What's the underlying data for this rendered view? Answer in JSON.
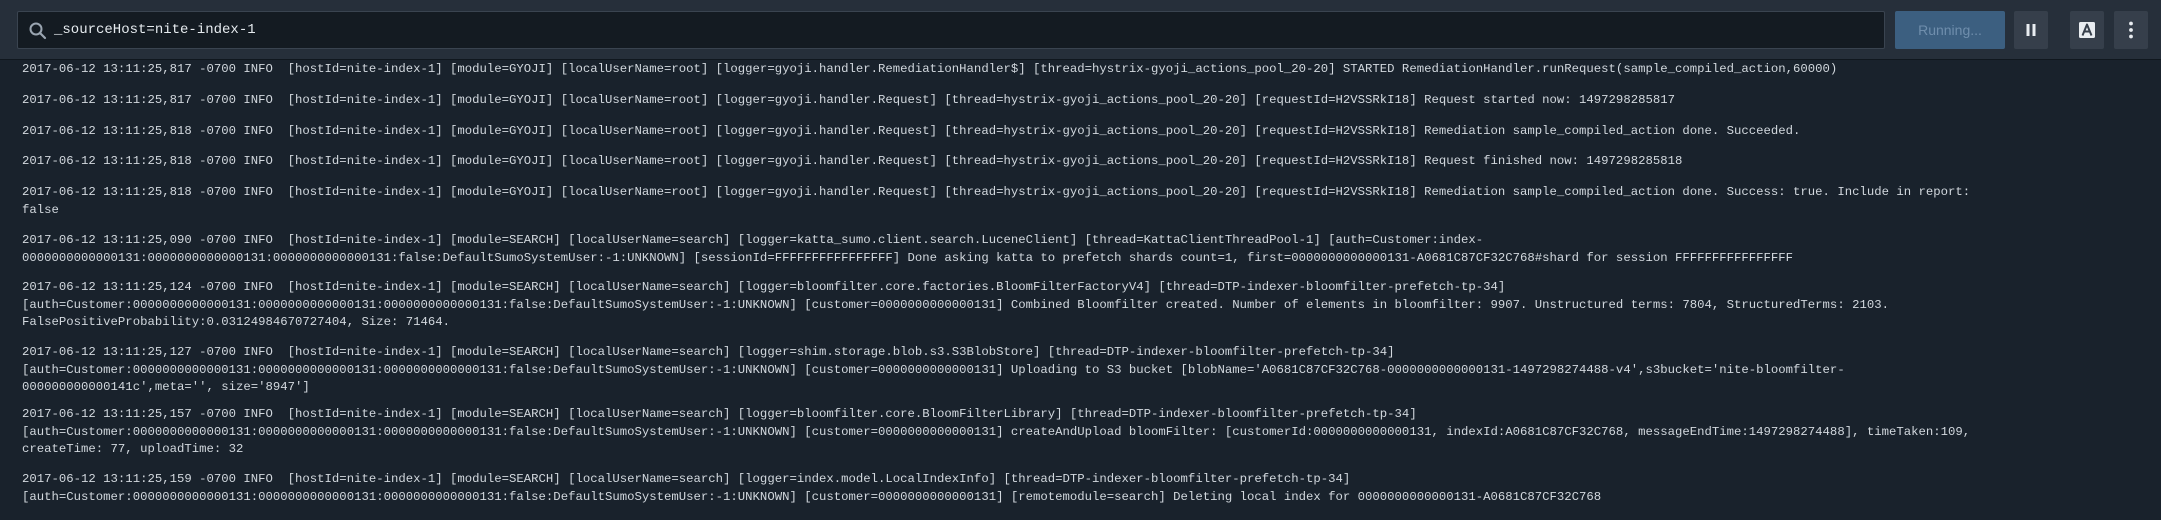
{
  "search": {
    "query": "_sourceHost=nite-index-1"
  },
  "controls": {
    "running_label": "Running..."
  },
  "colors": {
    "toolbar_bg": "#262f3a",
    "log_bg": "#19222c",
    "running_button": "#3c5f80"
  },
  "logs": [
    "2017-06-12 13:11:25,817 -0700 INFO  [hostId=nite-index-1] [module=GYOJI] [localUserName=root] [logger=gyoji.handler.RemediationHandler$] [thread=hystrix-gyoji_actions_pool_20-20] STARTED RemediationHandler.runRequest(sample_compiled_action,60000)",
    "2017-06-12 13:11:25,817 -0700 INFO  [hostId=nite-index-1] [module=GYOJI] [localUserName=root] [logger=gyoji.handler.Request] [thread=hystrix-gyoji_actions_pool_20-20] [requestId=H2VSSRkI18] Request started now: 1497298285817",
    "2017-06-12 13:11:25,818 -0700 INFO  [hostId=nite-index-1] [module=GYOJI] [localUserName=root] [logger=gyoji.handler.Request] [thread=hystrix-gyoji_actions_pool_20-20] [requestId=H2VSSRkI18] Remediation sample_compiled_action done. Succeeded.",
    "2017-06-12 13:11:25,818 -0700 INFO  [hostId=nite-index-1] [module=GYOJI] [localUserName=root] [logger=gyoji.handler.Request] [thread=hystrix-gyoji_actions_pool_20-20] [requestId=H2VSSRkI18] Request finished now: 1497298285818",
    "2017-06-12 13:11:25,818 -0700 INFO  [hostId=nite-index-1] [module=GYOJI] [localUserName=root] [logger=gyoji.handler.Request] [thread=hystrix-gyoji_actions_pool_20-20] [requestId=H2VSSRkI18] Remediation sample_compiled_action done. Success: true. Include in report:\nfalse",
    "2017-06-12 13:11:25,090 -0700 INFO  [hostId=nite-index-1] [module=SEARCH] [localUserName=search] [logger=katta_sumo.client.search.LuceneClient] [thread=KattaClientThreadPool-1] [auth=Customer:index-\n0000000000000131:0000000000000131:0000000000000131:false:DefaultSumoSystemUser:-1:UNKNOWN] [sessionId=FFFFFFFFFFFFFFFF] Done asking katta to prefetch shards count=1, first=0000000000000131-A0681C87CF32C768#shard for session FFFFFFFFFFFFFFFF",
    "2017-06-12 13:11:25,124 -0700 INFO  [hostId=nite-index-1] [module=SEARCH] [localUserName=search] [logger=bloomfilter.core.factories.BloomFilterFactoryV4] [thread=DTP-indexer-bloomfilter-prefetch-tp-34]\n[auth=Customer:0000000000000131:0000000000000131:0000000000000131:false:DefaultSumoSystemUser:-1:UNKNOWN] [customer=0000000000000131] Combined Bloomfilter created. Number of elements in bloomfilter: 9907. Unstructured terms: 7804, StructuredTerms: 2103.\nFalsePositiveProbability:0.03124984670727404, Size: 71464.",
    "2017-06-12 13:11:25,127 -0700 INFO  [hostId=nite-index-1] [module=SEARCH] [localUserName=search] [logger=shim.storage.blob.s3.S3BlobStore] [thread=DTP-indexer-bloomfilter-prefetch-tp-34]\n[auth=Customer:0000000000000131:0000000000000131:0000000000000131:false:DefaultSumoSystemUser:-1:UNKNOWN] [customer=0000000000000131] Uploading to S3 bucket [blobName='A0681C87CF32C768-0000000000000131-1497298274488-v4',s3bucket='nite-bloomfilter-\n000000000000141c',meta='', size='8947']",
    "2017-06-12 13:11:25,157 -0700 INFO  [hostId=nite-index-1] [module=SEARCH] [localUserName=search] [logger=bloomfilter.core.BloomFilterLibrary] [thread=DTP-indexer-bloomfilter-prefetch-tp-34]\n[auth=Customer:0000000000000131:0000000000000131:0000000000000131:false:DefaultSumoSystemUser:-1:UNKNOWN] [customer=0000000000000131] createAndUpload bloomFilter: [customerId:0000000000000131, indexId:A0681C87CF32C768, messageEndTime:1497298274488], timeTaken:109,\ncreateTime: 77, uploadTime: 32",
    "2017-06-12 13:11:25,159 -0700 INFO  [hostId=nite-index-1] [module=SEARCH] [localUserName=search] [logger=index.model.LocalIndexInfo] [thread=DTP-indexer-bloomfilter-prefetch-tp-34]\n[auth=Customer:0000000000000131:0000000000000131:0000000000000131:false:DefaultSumoSystemUser:-1:UNKNOWN] [customer=0000000000000131] [remotemodule=search] Deleting local index for 0000000000000131-A0681C87CF32C768"
  ]
}
